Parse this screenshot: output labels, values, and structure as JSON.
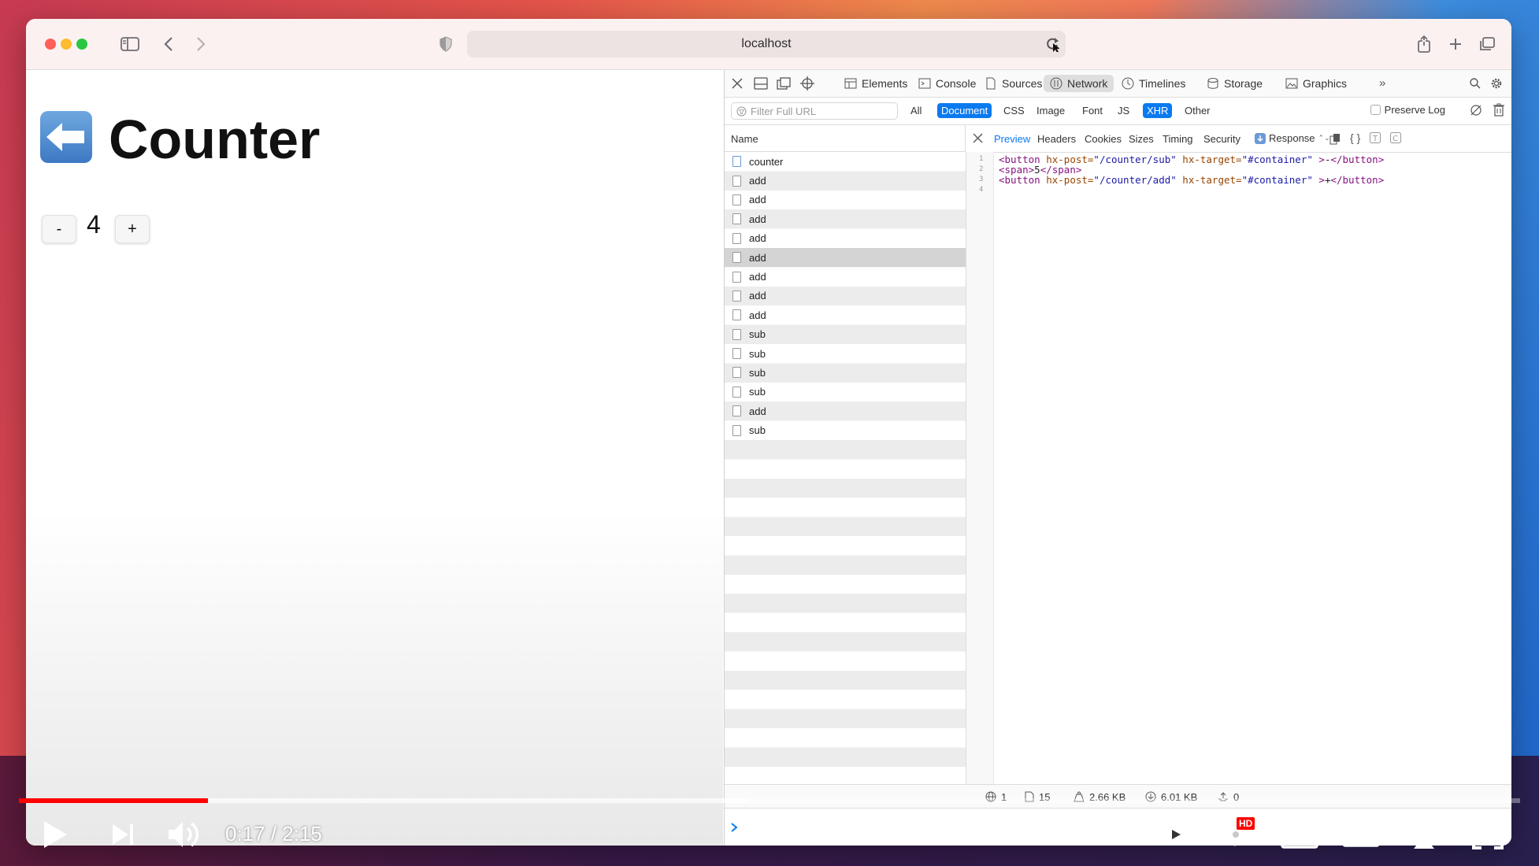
{
  "browser": {
    "url": "localhost"
  },
  "page": {
    "title": "Counter",
    "decrement_label": "-",
    "count": "4",
    "increment_label": "+"
  },
  "devtools": {
    "tabs": [
      "Elements",
      "Console",
      "Sources",
      "Network",
      "Timelines",
      "Storage",
      "Graphics"
    ],
    "active_tab": "Network",
    "filter_placeholder": "Filter Full URL",
    "type_filters": [
      "All",
      "Document",
      "CSS",
      "Image",
      "Font",
      "JS",
      "XHR",
      "Other"
    ],
    "selected_type_filters": [
      "Document",
      "XHR"
    ],
    "preserve_log_label": "Preserve Log",
    "list_header": "Name",
    "requests": [
      "counter",
      "add",
      "add",
      "add",
      "add",
      "add",
      "add",
      "add",
      "add",
      "sub",
      "sub",
      "sub",
      "sub",
      "add",
      "sub"
    ],
    "selected_request_index": 5,
    "detail_tabs": [
      "Preview",
      "Headers",
      "Cookies",
      "Sizes",
      "Timing",
      "Security"
    ],
    "active_detail_tab": "Preview",
    "response_label": "Response",
    "line_numbers": [
      "1",
      "2",
      "3",
      "4"
    ],
    "code": {
      "line1": {
        "open": "<button",
        "a1": " hx-post=",
        "v1": "\"/counter/sub\"",
        "a2": " hx-target=",
        "v2": "\"#container\"",
        "close": " >",
        "text": "-",
        "end": "</button>"
      },
      "line2": {
        "open": "<span>",
        "text": "5",
        "end": "</span>"
      },
      "line3": {
        "open": "<button",
        "a1": " hx-post=",
        "v1": "\"/counter/add\"",
        "a2": " hx-target=",
        "v2": "\"#container\"",
        "close": " >",
        "text": "+",
        "end": "</button>"
      }
    },
    "status": {
      "domains": "1",
      "resources": "15",
      "transferred": "2.66 KB",
      "size": "6.01 KB",
      "errors": "0"
    }
  },
  "video": {
    "time": "0:17 / 2:15",
    "played_fraction": 0.126,
    "buffered_fraction": 0.486,
    "hd_badge": "HD"
  },
  "colors": {
    "accent": "#0a7af0",
    "progress": "#ff0000"
  }
}
